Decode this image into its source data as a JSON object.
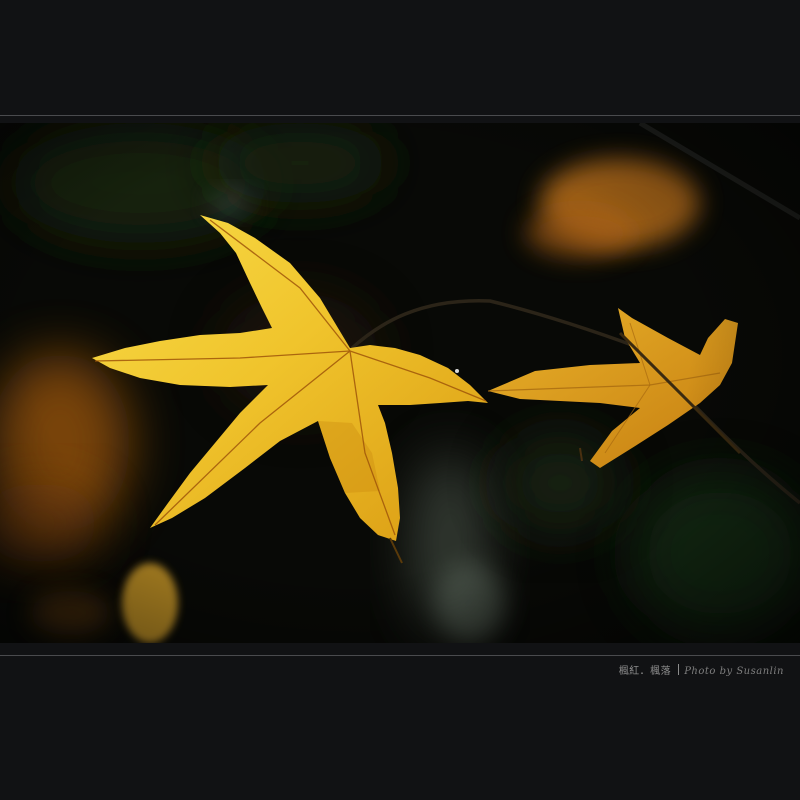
{
  "caption": {
    "title": "楓紅．楓落",
    "credit": "Photo by Susanlin"
  },
  "photo": {
    "subject": "backlit yellow maple leaves",
    "colors": {
      "frame": "#111214",
      "background": "#070806",
      "leaf_light": "#f6d640",
      "leaf_mid": "#e4a514",
      "leaf_dark": "#b06a0a",
      "bokeh_orange": "#c77818",
      "bokeh_green": "#1d3a1a"
    }
  }
}
